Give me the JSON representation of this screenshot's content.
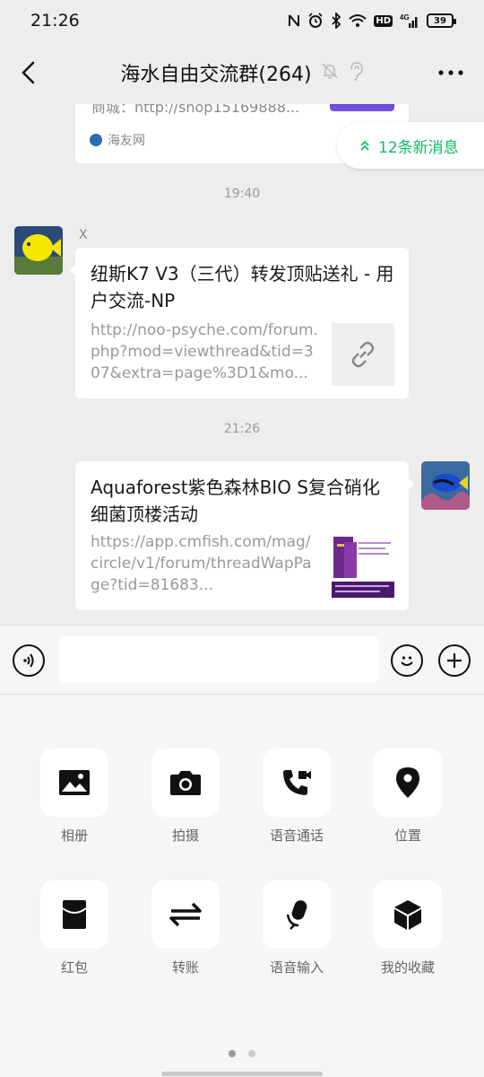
{
  "status": {
    "time": "21:26",
    "network": "4G",
    "hd": "HD",
    "battery": "39"
  },
  "nav": {
    "title": "海水自由交流群(264)"
  },
  "chat": {
    "top_card": {
      "url": "商城：http://shop15169888...",
      "source": "海友网"
    },
    "new_messages": "12条新消息",
    "time1": "19:40",
    "msg1": {
      "sender": "X",
      "title": "纽斯K7 V3（三代）转发顶贴送礼 - 用户交流-NP",
      "desc": "http://noo-psyche.com/forum.php?mod=viewthread&tid=307&extra=page%3D1&mo..."
    },
    "time2": "21:26",
    "msg2": {
      "title": "Aquaforest紫色森林BIO S复合硝化细菌顶楼活动",
      "desc": "https://app.cmfish.com/mag/circle/v1/forum/threadWapPage?tid=81683..."
    }
  },
  "tools": [
    {
      "label": "相册",
      "icon": "album-icon"
    },
    {
      "label": "拍摄",
      "icon": "camera-icon"
    },
    {
      "label": "语音通话",
      "icon": "voice-call-icon"
    },
    {
      "label": "位置",
      "icon": "location-icon"
    },
    {
      "label": "红包",
      "icon": "red-packet-icon"
    },
    {
      "label": "转账",
      "icon": "transfer-icon"
    },
    {
      "label": "语音输入",
      "icon": "voice-input-icon"
    },
    {
      "label": "我的收藏",
      "icon": "favorites-icon"
    }
  ]
}
